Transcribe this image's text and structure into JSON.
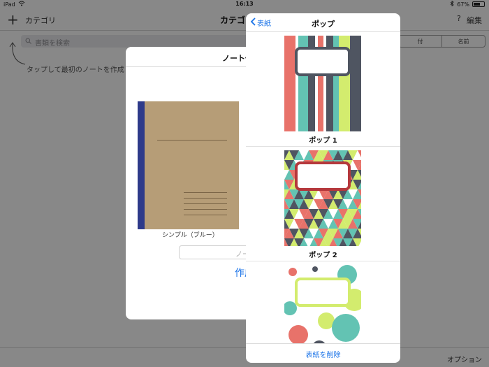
{
  "status": {
    "device": "iPad",
    "time": "16:13",
    "battery": "67%",
    "battery_level": 0.67
  },
  "nav": {
    "add_glyph": "+",
    "category_label": "カテゴリ",
    "title": "カテゴリ",
    "help_glyph": "?",
    "edit_label": "編集"
  },
  "search": {
    "placeholder": "書類を検索",
    "sort_options": [
      "付",
      "名前"
    ]
  },
  "hint": "タップして最初のノートを作成",
  "bottom": {
    "options_label": "オプション"
  },
  "dialog": {
    "title": "ノート作",
    "cover_caption": "シンプル（ブルー）",
    "name_placeholder": "ノー",
    "create_label": "作成"
  },
  "popover": {
    "back_label": "表紙",
    "title": "ポップ",
    "covers": [
      {
        "name": "ポップ 1",
        "pattern": "stripes"
      },
      {
        "name": "ポップ 2",
        "pattern": "triangles"
      },
      {
        "name": "",
        "pattern": "dots"
      }
    ],
    "delete_label": "表紙を削除"
  },
  "colors": {
    "accent": "#1a73e8",
    "simple_cover": "#b69d77",
    "simple_spine": "#2e3a8a",
    "pop_red": "#e8726a",
    "pop_teal": "#63c3b3",
    "pop_lime": "#d3ec6e",
    "pop_slate": "#4f5561",
    "pop_maroon": "#b5383c"
  }
}
